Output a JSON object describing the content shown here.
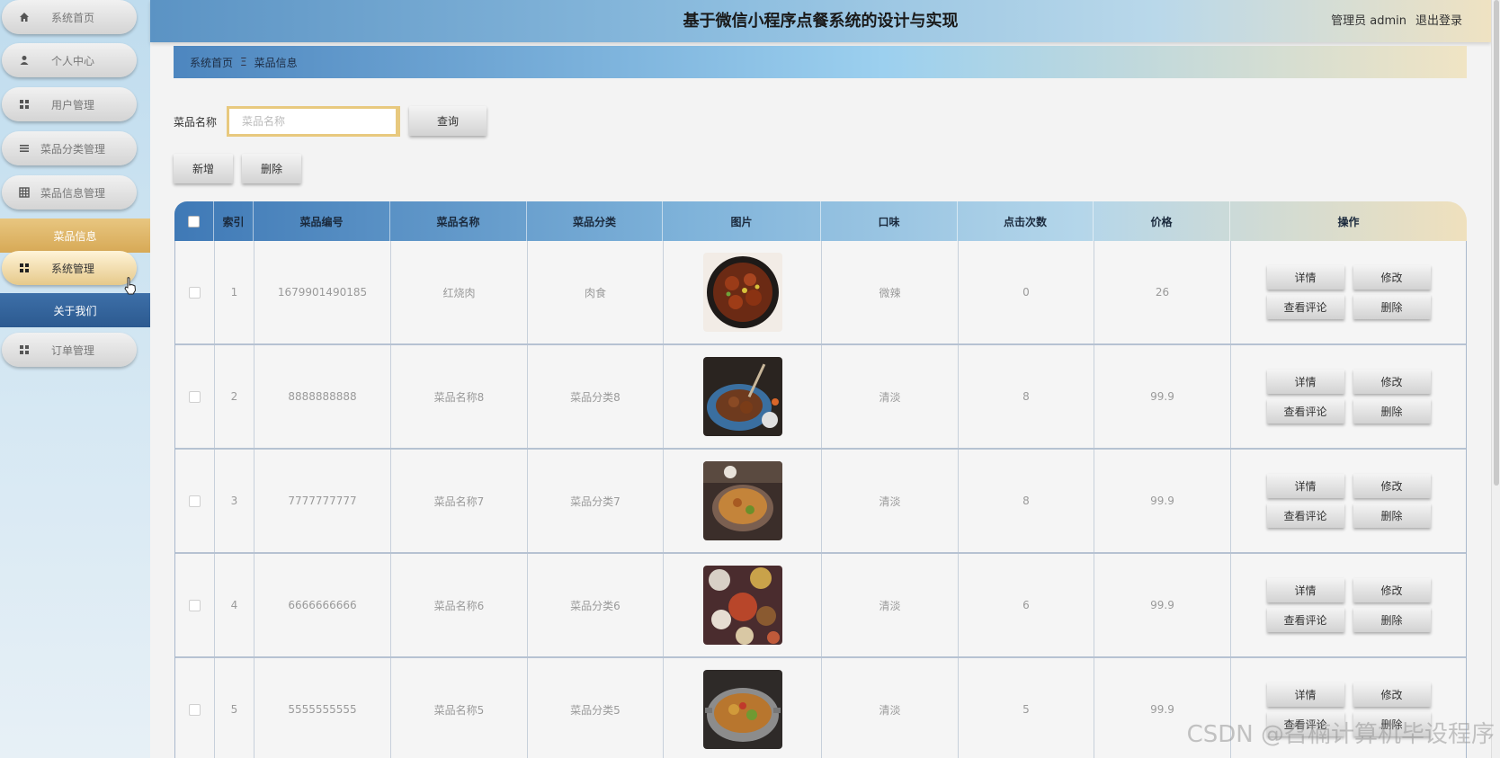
{
  "sidebar": {
    "items": [
      {
        "label": "系统首页",
        "icon": "home-icon"
      },
      {
        "label": "个人中心",
        "icon": "user-icon"
      },
      {
        "label": "用户管理",
        "icon": "grid-icon"
      },
      {
        "label": "菜品分类管理",
        "icon": "list-icon"
      },
      {
        "label": "菜品信息管理",
        "icon": "table-icon"
      },
      {
        "label": "菜品信息"
      },
      {
        "label": "系统管理",
        "icon": "grid-icon"
      },
      {
        "label": "关于我们"
      },
      {
        "label": "订单管理",
        "icon": "grid-icon"
      }
    ]
  },
  "header": {
    "title": "基于微信小程序点餐系统的设计与实现",
    "user": "管理员 admin",
    "logout": "退出登录"
  },
  "breadcrumb": {
    "home": "系统首页",
    "separator": "Ξ",
    "current": "菜品信息"
  },
  "search": {
    "label": "菜品名称",
    "placeholder": "菜品名称",
    "button": "查询"
  },
  "actions": {
    "add": "新增",
    "delete": "删除"
  },
  "table": {
    "columns": [
      "",
      "索引",
      "菜品编号",
      "菜品名称",
      "菜品分类",
      "图片",
      "口味",
      "点击次数",
      "价格",
      "操作"
    ],
    "rows": [
      {
        "index": "1",
        "code": "1679901490185",
        "name": "红烧肉",
        "category": "肉食",
        "taste": "微辣",
        "clicks": "0",
        "price": "26"
      },
      {
        "index": "2",
        "code": "8888888888",
        "name": "菜品名称8",
        "category": "菜品分类8",
        "taste": "清淡",
        "clicks": "8",
        "price": "99.9"
      },
      {
        "index": "3",
        "code": "7777777777",
        "name": "菜品名称7",
        "category": "菜品分类7",
        "taste": "清淡",
        "clicks": "8",
        "price": "99.9"
      },
      {
        "index": "4",
        "code": "6666666666",
        "name": "菜品名称6",
        "category": "菜品分类6",
        "taste": "清淡",
        "clicks": "6",
        "price": "99.9"
      },
      {
        "index": "5",
        "code": "5555555555",
        "name": "菜品名称5",
        "category": "菜品分类5",
        "taste": "清淡",
        "clicks": "5",
        "price": "99.9"
      }
    ],
    "row_buttons": {
      "detail": "详情",
      "edit": "修改",
      "comments": "查看评论",
      "delete": "删除"
    }
  },
  "watermark": "CSDN @召楠计算机毕设程序"
}
